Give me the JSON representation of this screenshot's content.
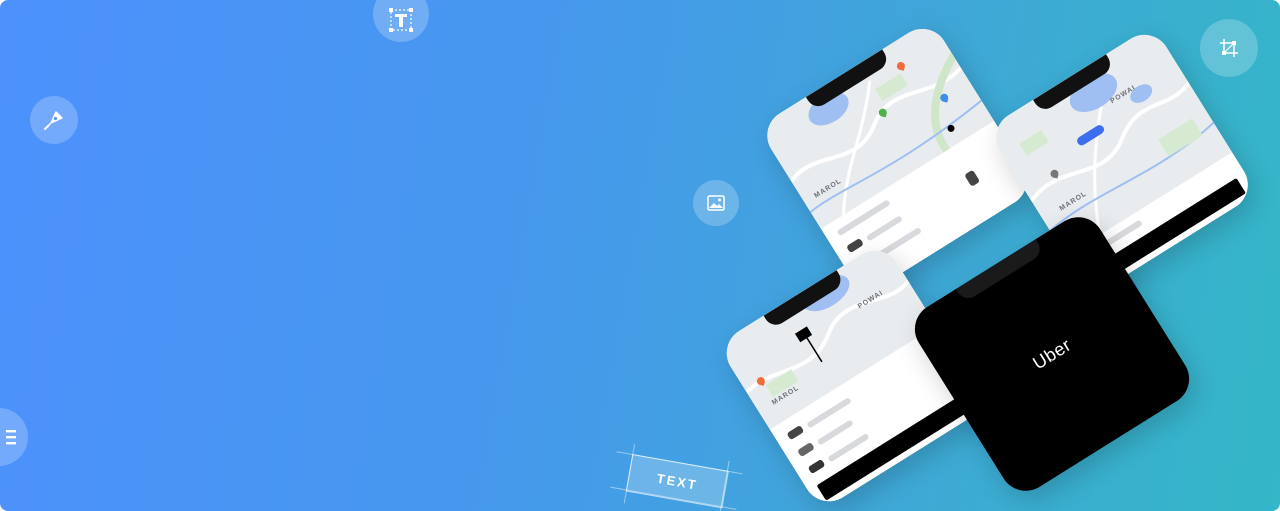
{
  "hero": {
    "background_start": "#4d91fd",
    "background_end": "#34b7c7"
  },
  "tool_icons": [
    "pen-tool-icon",
    "text-tool-icon",
    "image-icon",
    "crop-icon",
    "menu-icon"
  ],
  "text_tag": {
    "label": "TEXT"
  },
  "phones": {
    "splash": {
      "brand": "Uber",
      "background": "#000000"
    },
    "map_labels": {
      "powai": "POWAI",
      "marol": "MAROL"
    }
  }
}
